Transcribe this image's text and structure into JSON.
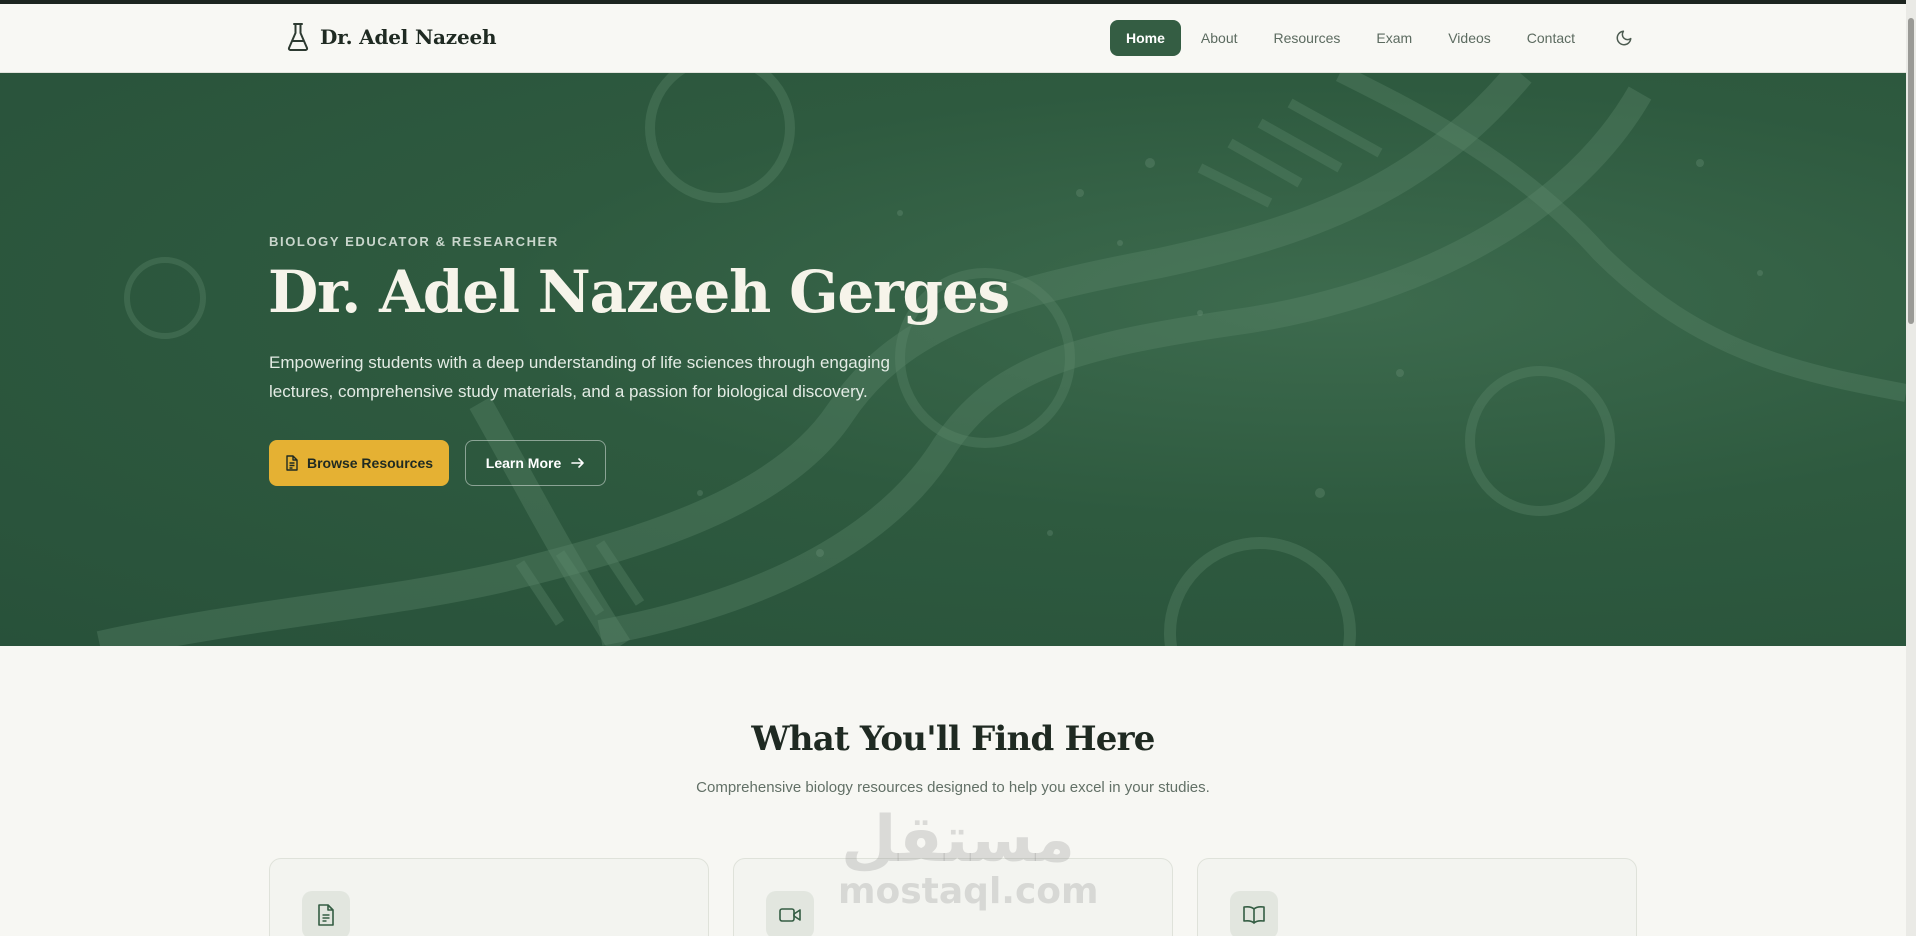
{
  "header": {
    "brand_name": "Dr. Adel Nazeeh",
    "nav": [
      "Home",
      "About",
      "Resources",
      "Exam",
      "Videos",
      "Contact"
    ],
    "active": "Home"
  },
  "hero": {
    "eyebrow": "BIOLOGY EDUCATOR & RESEARCHER",
    "title": "Dr. Adel Nazeeh Gerges",
    "description": "Empowering students with a deep understanding of life sciences through engaging lectures, comprehensive study materials, and a passion for biological discovery.",
    "primary_button": "Browse Resources",
    "secondary_button": "Learn More"
  },
  "features": {
    "title": "What You'll Find Here",
    "subtitle": "Comprehensive biology resources designed to help you excel in your studies.",
    "cards": [
      {
        "icon": "document-icon"
      },
      {
        "icon": "video-icon"
      },
      {
        "icon": "book-icon"
      }
    ]
  },
  "watermark": {
    "arabic": "مستقل",
    "latin": "mostaql.com"
  },
  "colors": {
    "primary_green": "#345d43",
    "hero_bg": "#2e5a3f",
    "accent_yellow": "#e5b133",
    "page_bg": "#f7f7f3"
  }
}
